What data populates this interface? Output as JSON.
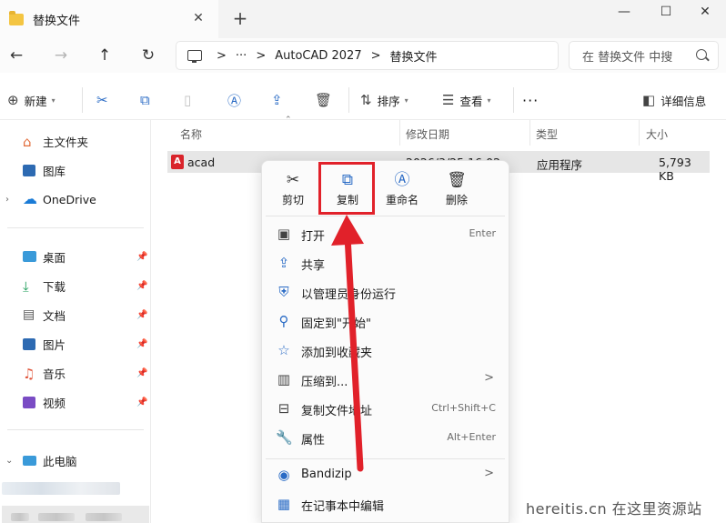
{
  "window": {
    "tab_title": "替换文件",
    "close_tab": "✕",
    "new_tab": "+",
    "minimize": "—",
    "maximize": "☐",
    "close": "✕"
  },
  "address": {
    "back": "←",
    "forward": "→",
    "up": "↑",
    "refresh": "↻",
    "overflow": "···",
    "crumbs": [
      "AutoCAD 2027",
      "替换文件"
    ],
    "chevron": ">",
    "search_placeholder": "在 替换文件 中搜"
  },
  "commandbar": {
    "new_label": "新建",
    "sort_label": "排序",
    "view_label": "查看",
    "more": "···",
    "details_label": "详细信息"
  },
  "sidebar": {
    "home": "主文件夹",
    "gallery": "图库",
    "onedrive": "OneDrive",
    "quick": [
      "桌面",
      "下载",
      "文档",
      "图片",
      "音乐",
      "视频"
    ],
    "pc": "此电脑"
  },
  "filelist": {
    "columns": [
      "名称",
      "修改日期",
      "类型",
      "大小"
    ],
    "files": [
      {
        "name": "acad",
        "icon_letter": "A",
        "date": "2026/3/25 16:02",
        "type": "应用程序",
        "size": "5,793 KB"
      }
    ]
  },
  "context_menu": {
    "quick_actions": [
      "剪切",
      "复制",
      "重命名",
      "删除"
    ],
    "items": [
      {
        "label": "打开",
        "key": "Enter"
      },
      {
        "label": "共享",
        "key": ""
      },
      {
        "label": "以管理员身份运行",
        "key": ""
      },
      {
        "label": "固定到\"开始\"",
        "key": ""
      },
      {
        "label": "添加到收藏夹",
        "key": ""
      },
      {
        "label": "压缩到...",
        "key": ""
      },
      {
        "label": "复制文件地址",
        "key": "Ctrl+Shift+C"
      },
      {
        "label": "属性",
        "key": "Alt+Enter"
      },
      {
        "label": "Bandizip",
        "key": ""
      },
      {
        "label": "在记事本中编辑",
        "key": ""
      }
    ],
    "submenu_arrow": ">"
  },
  "annotation": {
    "highlight_color": "#e1212a"
  },
  "watermark": {
    "text": "hereitis.cn 在这里资源站"
  },
  "colors": {
    "accent": "#2a6bc5",
    "selection": "#e6e6e6"
  }
}
